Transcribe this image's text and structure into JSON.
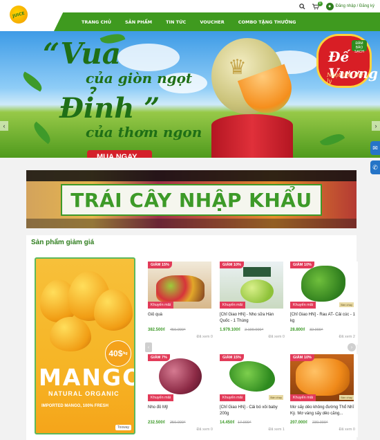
{
  "header": {
    "logo_text": "JUICE",
    "cart_count": "0",
    "login_label": "Đăng nhập / Đăng ký"
  },
  "nav": [
    {
      "label": "TRANG CHỦ"
    },
    {
      "label": "SẢN PHẨM"
    },
    {
      "label": "TIN TỨC"
    },
    {
      "label": "VOUCHER"
    },
    {
      "label": "COMBO TẶNG THƯỞNG"
    }
  ],
  "banner": {
    "line1": "“Vua",
    "line2": "của giòn ngọt",
    "line3": "Đỉnh ”",
    "line4": "của thơm ngon",
    "cta": "MUA NGAY",
    "brand_top": "ĐẢM BẢO SẠCH",
    "brand_name": "Đế Vương",
    "brand_tag": "Ngọt lịm, mê ly"
  },
  "section_banner": {
    "title": "TRÁI CÂY NHẬP KHẨU"
  },
  "products_section": {
    "title": "Sản phẩm giảm giá",
    "promo_image": {
      "name": "MANGO",
      "subtitle": "NATURAL ORGANIC",
      "price": "40$",
      "price_unit": "/kg",
      "headline": "IMPORTED MANGO, 100% FRESH",
      "brand": "Tooway"
    },
    "items": [
      {
        "discount": "GIẢM 15%",
        "promo": "Khuyến mãi",
        "tag": "",
        "name": "Giỏ quà",
        "price": "382.500₫",
        "old_price": "450.000₫",
        "views": "Đã xem 0"
      },
      {
        "discount": "GIẢM 10%",
        "promo": "Khuyến mãi",
        "tag": "",
        "name": "[Chỉ Giao HN] - Nho sữa Hàn Quốc - 1 Thùng",
        "price": "1.979.100₫",
        "old_price": "2.199.000₫",
        "views": "Đã xem 0"
      },
      {
        "discount": "GIẢM 10%",
        "promo": "Khuyến mãi",
        "tag": "Bán chạy",
        "name": "[Chỉ Giao HN] - Rau AT- Cải cúc - 1 kg",
        "price": "28.800₫",
        "old_price": "32.000₫",
        "views": "Đã xem 2"
      },
      {
        "discount": "GIẢM 7%",
        "promo": "Khuyến mãi",
        "tag": "",
        "name": "Nho đỏ Mỹ",
        "price": "232.500₫",
        "old_price": "250.000₫",
        "views": "Đã xem 0"
      },
      {
        "discount": "GIẢM 15%",
        "promo": "Khuyến mãi",
        "tag": "Bán chạy",
        "name": "[Chỉ Giao HN] - Cải bó xôi baby 200g",
        "price": "14.450₫",
        "old_price": "17.000₫",
        "views": "Đã xem 1"
      },
      {
        "discount": "GIẢM 10%",
        "promo": "Khuyến mãi",
        "tag": "Bán chạy",
        "name": "Mơ sấy dẻo không đường Thổ Nhĩ Kỳ. Mơ vàng sấy dẻo căng...",
        "price": "207.000₫",
        "old_price": "230.000₫",
        "views": "Đã xem 0"
      }
    ]
  },
  "colors": {
    "brand_green": "#3f9a1f",
    "discount_pink": "#e23b59",
    "promo_red": "#d4202a"
  }
}
